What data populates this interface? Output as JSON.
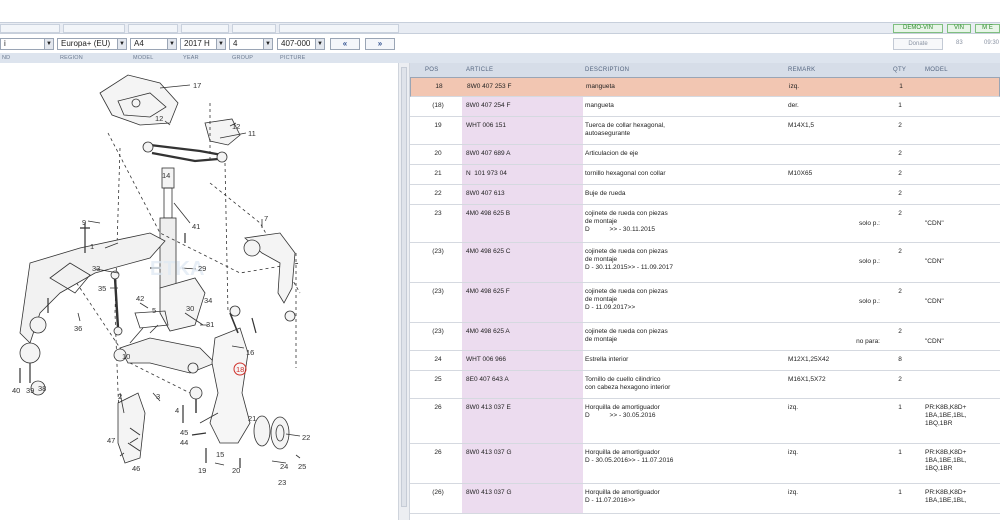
{
  "top_buttons": {
    "demo_vin": "DEMO-VIN",
    "vin": "VIN",
    "more": "M E"
  },
  "filters": {
    "brand": "i",
    "region": "Europa+ (EU)",
    "model": "A4",
    "year": "2017  H",
    "group": "4",
    "picture": "407-000",
    "prev": "«",
    "next": "»",
    "donate": "Donate",
    "count": "83",
    "time": "09:30"
  },
  "filter_labels": [
    "ND",
    "REGION",
    "MODEL",
    "YEAR",
    "GROUP",
    "PICTURE"
  ],
  "columns": {
    "pos": "POS",
    "article": "ARTICLE",
    "description": "DESCRIPTION",
    "remark": "REMARK",
    "qty": "QTY",
    "model": "MODEL"
  },
  "rows": [
    {
      "pos": "18",
      "article": "8W0 407 253 F",
      "description": "mangueta",
      "remark": "izq.",
      "note": "",
      "qty": "1",
      "model": ""
    },
    {
      "pos": "(18)",
      "article": "8W0 407 254 F",
      "description": "mangueta",
      "remark": "der.",
      "note": "",
      "qty": "1",
      "model": ""
    },
    {
      "pos": "19",
      "article": "WHT 006 151",
      "description": "Tuerca de collar hexagonal,\nautoasegurante",
      "remark": "M14X1,5",
      "note": "",
      "qty": "2",
      "model": ""
    },
    {
      "pos": "20",
      "article": "8W0 407 689 A",
      "description": "Articulacion de eje",
      "remark": "",
      "note": "",
      "qty": "2",
      "model": ""
    },
    {
      "pos": "21",
      "article": "N  101 973 04",
      "description": "tornillo hexagonal con collar",
      "remark": "M10X65",
      "note": "",
      "qty": "2",
      "model": ""
    },
    {
      "pos": "22",
      "article": "8W0 407 613",
      "description": "Buje de rueda",
      "remark": "",
      "note": "",
      "qty": "2",
      "model": ""
    },
    {
      "pos": "23",
      "article": "4M0 498 625 B",
      "description": "cojinete de rueda con piezas\nde montaje\nD           >> - 30.11.2015",
      "remark": "",
      "note": "solo p.:",
      "qty": "2",
      "model": "\"CDN\""
    },
    {
      "pos": "(23)",
      "article": "4M0 498 625 C",
      "description": "cojinete de rueda con piezas\nde montaje\nD - 30.11.2015>> - 11.09.2017",
      "remark": "",
      "note": "solo p.:",
      "qty": "2",
      "model": "\"CDN\""
    },
    {
      "pos": "(23)",
      "article": "4M0 498 625 F",
      "description": "cojinete de rueda con piezas\nde montaje\nD - 11.09.2017>>",
      "remark": "",
      "note": "solo p.:",
      "qty": "2",
      "model": "\"CDN\""
    },
    {
      "pos": "(23)",
      "article": "4M0 498 625 A",
      "description": "cojinete de rueda con piezas\nde montaje",
      "remark": "",
      "note": "no para:",
      "qty": "2",
      "model": "\"CDN\""
    },
    {
      "pos": "24",
      "article": "WHT 006 966",
      "description": "Estrella interior",
      "remark": "M12X1,25X42",
      "note": "",
      "qty": "8",
      "model": ""
    },
    {
      "pos": "25",
      "article": "8E0 407 643 A",
      "description": "Tornillo de cuello cilindrico\ncon cabeza hexagono interior",
      "remark": "M16X1,5X72",
      "note": "",
      "qty": "2",
      "model": ""
    },
    {
      "pos": "26",
      "article": "8W0 413 037 E",
      "description": "Horquilla de amortiguador\nD           >> - 30.05.2016",
      "remark": "izq.",
      "note": "",
      "qty": "1",
      "model": "PR:K8B,K8D+\n1BA,1BE,1BL,\n1BQ,1BR"
    },
    {
      "pos": "26",
      "article": "8W0 413 037 G",
      "description": "Horquilla de amortiguador\nD - 30.05.2016>> - 11.07.2016",
      "remark": "izq.",
      "note": "",
      "qty": "1",
      "model": "PR:K8B,K8D+\n1BA,1BE,1BL,\n1BQ,1BR"
    },
    {
      "pos": "(26)",
      "article": "8W0 413 037 G",
      "description": "Horquilla de amortiguador\nD - 11.07.2016>>",
      "remark": "izq.",
      "note": "",
      "qty": "1",
      "model": "PR:K8B,K8D+\n1BA,1BE,1BL,"
    }
  ],
  "diagram": {
    "callouts": [
      "17",
      "12",
      "11",
      "12",
      "41",
      "9",
      "7",
      "1",
      "33",
      "35",
      "29",
      "34",
      "36",
      "42",
      "5",
      "30",
      "31",
      "16",
      "18",
      "10",
      "39",
      "38",
      "40",
      "2",
      "3",
      "4",
      "47",
      "45",
      "44",
      "46",
      "19",
      "20",
      "21",
      "22",
      "23",
      "24",
      "25",
      "15",
      "14"
    ],
    "highlight_color": "#d0302a"
  },
  "colors": {
    "selected_row": "#f2c6b2",
    "article_col": "#ecdcef",
    "header": "#d6dde8"
  }
}
